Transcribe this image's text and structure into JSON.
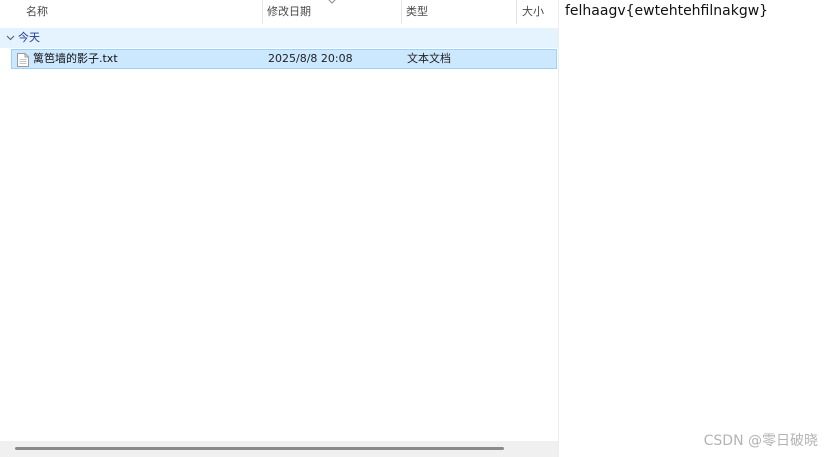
{
  "explorer": {
    "columns": {
      "name": "名称",
      "date": "修改日期",
      "type": "类型",
      "size": "大小"
    },
    "group": {
      "label": "今天"
    },
    "files": [
      {
        "name": "篱笆墙的影子.txt",
        "modified": "2025/8/8 20:08",
        "type": "文本文档",
        "size": "",
        "icon": "text-file-icon"
      }
    ]
  },
  "preview": {
    "content": "felhaagv{ewtehtehfilnakgw}"
  },
  "watermark": "CSDN @零日破晓",
  "colors": {
    "selection_bg": "#cce8ff",
    "selection_border": "#99d1ff",
    "group_bg": "#e5f3ff",
    "group_text": "#1f3a93"
  }
}
